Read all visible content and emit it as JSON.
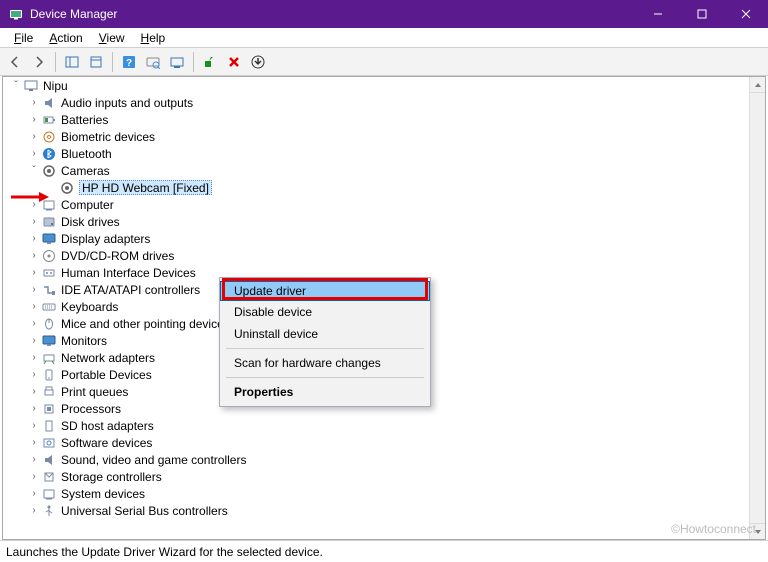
{
  "window": {
    "title": "Device Manager"
  },
  "menu": {
    "file": "File",
    "action": "Action",
    "view": "View",
    "help": "Help"
  },
  "tree": {
    "root": "Nipu",
    "nodes": [
      "Audio inputs and outputs",
      "Batteries",
      "Biometric devices",
      "Bluetooth",
      "Cameras",
      "Computer",
      "Disk drives",
      "Display adapters",
      "DVD/CD-ROM drives",
      "Human Interface Devices",
      "IDE ATA/ATAPI controllers",
      "Keyboards",
      "Mice and other pointing devices",
      "Monitors",
      "Network adapters",
      "Portable Devices",
      "Print queues",
      "Processors",
      "SD host adapters",
      "Software devices",
      "Sound, video and game controllers",
      "Storage controllers",
      "System devices",
      "Universal Serial Bus controllers"
    ],
    "camera_child": "HP HD Webcam [Fixed]"
  },
  "context_menu": {
    "update": "Update driver",
    "disable": "Disable device",
    "uninstall": "Uninstall device",
    "scan": "Scan for hardware changes",
    "properties": "Properties"
  },
  "statusbar": {
    "text": "Launches the Update Driver Wizard for the selected device."
  },
  "watermark": "©Howtoconnect"
}
